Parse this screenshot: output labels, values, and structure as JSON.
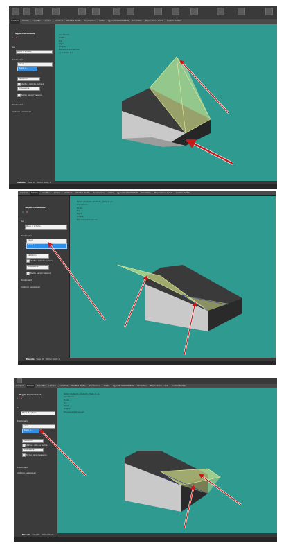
{
  "tabs": [
    "Funzioni",
    "Schizzo",
    "Superfici",
    "Lamiera",
    "Saldature",
    "Modifica diretta",
    "Annotazione",
    "Valuta",
    "Aggiunte SOLIDWORKS",
    "Simulation",
    "Preparazione analisi",
    "Custom Toolbar"
  ],
  "feature": {
    "title": "Taglio-Estrusione",
    "title_numbered": "Taglio-Estrusione1",
    "from_label": "Da",
    "from_value": "Piano di schizzo",
    "dir1_label": "Direzione 1",
    "end_condition": "Cieco",
    "depth": "Mezzo a...",
    "depth_value": "10.00mm",
    "draft_label": "Dimensione",
    "flip_label": "Ribalta il lato da togliere",
    "draft_outward": "Sformo verso l'esterno",
    "dir2_label": "Direzione 2",
    "contours_label": "Contorni selezionati"
  },
  "tree": {
    "root": "Parte1 (Default<<Default>_Stato di vis",
    "history": "Annotazioni ...",
    "items": [
      "Fronte",
      "Top",
      "Right",
      "Origine"
    ],
    "extrude1": "Estrusione-Estrusione1",
    "sketch": "(-) Schizzo4 [1]",
    "cut": "Taglio-Estrusione1"
  },
  "bottom_tabs": [
    "Modello",
    "Viste 3D",
    "Motion Study 1"
  ],
  "colors": {
    "viewport": "#2f9a90",
    "solid_light": "#c7c7c7",
    "solid_dark": "#3a3a3a",
    "preview": "#d9e68a",
    "arrow": "#c81818"
  }
}
